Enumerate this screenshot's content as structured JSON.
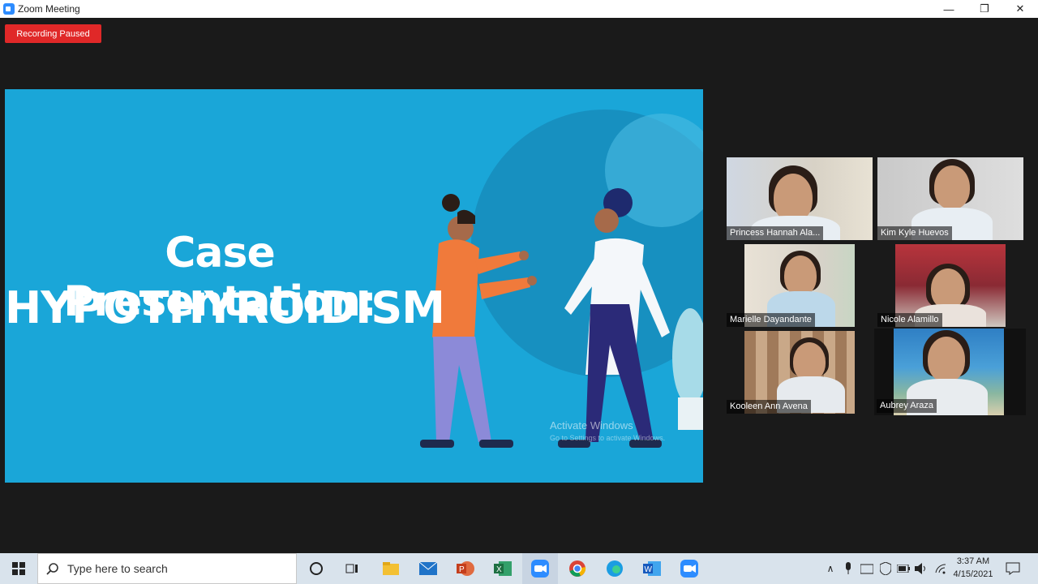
{
  "window": {
    "title": "Zoom Meeting",
    "minimize_glyph": "—",
    "restore_glyph": "❐",
    "close_glyph": "✕"
  },
  "meeting": {
    "recording_badge": "Recording Paused"
  },
  "slide": {
    "title_line1": "Case Presentation:",
    "title_line2": "HYPOTHYROIDISM",
    "watermark_line1": "Activate Windows",
    "watermark_line2": "Go to Settings to activate Windows."
  },
  "participants": [
    {
      "name": "Princess Hannah Ala...",
      "active": false
    },
    {
      "name": "Kim Kyle Huevos",
      "active": false
    },
    {
      "name": "Marielle Dayandante",
      "active": false
    },
    {
      "name": "Nicole Alamillo",
      "active": false
    },
    {
      "name": "Kooleen Ann Avena",
      "active": false
    },
    {
      "name": "Aubrey Araza",
      "active": true
    }
  ],
  "taskbar": {
    "search_placeholder": "Type here to search",
    "apps": [
      "cortana-icon",
      "task-view-icon",
      "file-explorer-icon",
      "mail-icon",
      "powerpoint-icon",
      "excel-icon",
      "zoom-icon",
      "chrome-icon",
      "edge-icon",
      "word-icon",
      "zoom-icon-2"
    ],
    "time": "3:37 AM",
    "date": "4/15/2021"
  },
  "colors": {
    "slide_bg": "#1aa6d8",
    "recording_red": "#e02828",
    "active_speaker": "#e8e88a"
  }
}
